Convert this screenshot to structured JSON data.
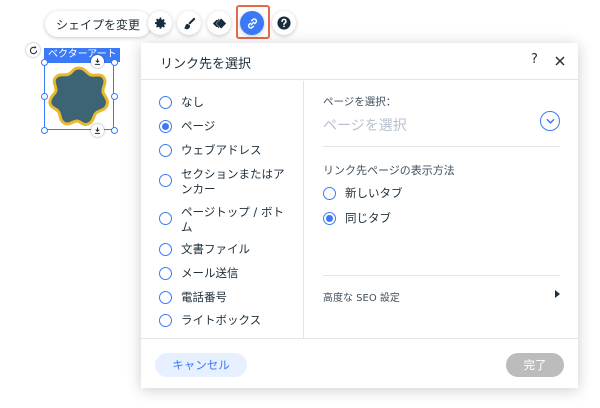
{
  "toolbar": {
    "change_shape_label": "シェイプを変更",
    "icons": [
      "gear-icon",
      "brush-icon",
      "animation-icon",
      "link-icon",
      "help-icon"
    ]
  },
  "element": {
    "label": "ベクターアート",
    "fill_color": "#3d6474",
    "border_color": "#e8b92a"
  },
  "dialog": {
    "title": "リンク先を選択",
    "help": "?",
    "link_types": [
      {
        "label": "なし",
        "checked": false
      },
      {
        "label": "ページ",
        "checked": true
      },
      {
        "label": "ウェブアドレス",
        "checked": false
      },
      {
        "label": "セクションまたはアンカー",
        "checked": false
      },
      {
        "label": "ページトップ / ボトム",
        "checked": false
      },
      {
        "label": "文書ファイル",
        "checked": false
      },
      {
        "label": "メール送信",
        "checked": false
      },
      {
        "label": "電話番号",
        "checked": false
      },
      {
        "label": "ライトボックス",
        "checked": false
      }
    ],
    "page_select": {
      "label": "ページを選択：",
      "placeholder": "ページを選択"
    },
    "open_mode": {
      "label": "リンク先ページの表示方法",
      "options": [
        {
          "label": "新しいタブ",
          "checked": false
        },
        {
          "label": "同じタブ",
          "checked": true
        }
      ]
    },
    "seo_label": "高度な SEO 設定",
    "cancel_label": "キャンセル",
    "done_label": "完了"
  },
  "colors": {
    "accent": "#3b7af6",
    "highlight": "#e8694a",
    "disabled": "#bcbcbc"
  }
}
